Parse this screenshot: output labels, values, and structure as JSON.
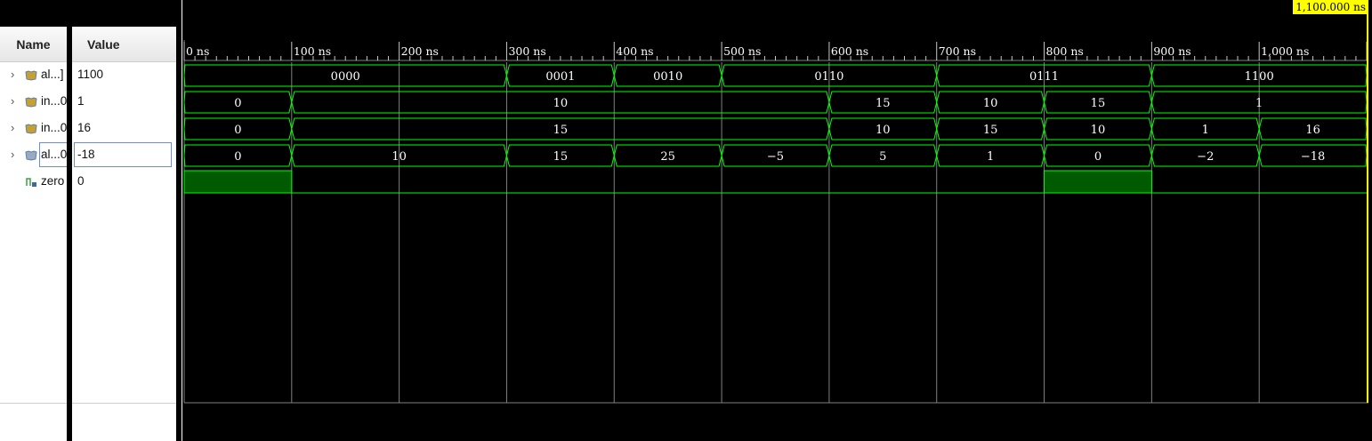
{
  "cursor_time": "1,100.000 ns",
  "headers": {
    "name": "Name",
    "value": "Value"
  },
  "signals": [
    {
      "name": "al...]",
      "value": "1100",
      "icon": "bus-icon",
      "expandable": true
    },
    {
      "name": "in...0",
      "value": "1",
      "icon": "bus-icon",
      "expandable": true
    },
    {
      "name": "in...0",
      "value": "16",
      "icon": "bus-icon",
      "expandable": true
    },
    {
      "name": "al...0",
      "value": "-18",
      "icon": "bus-icon",
      "expandable": true,
      "selected": true
    },
    {
      "name": "zero",
      "value": "0",
      "icon": "bit-icon",
      "expandable": false
    }
  ],
  "time_ticks": [
    "0 ns",
    "100 ns",
    "200 ns",
    "300 ns",
    "400 ns",
    "500 ns",
    "600 ns",
    "700 ns",
    "800 ns",
    "900 ns",
    "1,000 ns"
  ],
  "time_range_ns": [
    0,
    1100
  ],
  "colors": {
    "wave": "#00ff00",
    "bit_high_fill": "#005a00",
    "grid": "#808080",
    "cursor": "#ffff00",
    "text": "#ffffff"
  },
  "waves": [
    {
      "segments": [
        {
          "start": 0,
          "end": 300,
          "label": "0000"
        },
        {
          "start": 300,
          "end": 400,
          "label": "0001"
        },
        {
          "start": 400,
          "end": 500,
          "label": "0010"
        },
        {
          "start": 500,
          "end": 700,
          "label": "0110"
        },
        {
          "start": 700,
          "end": 900,
          "label": "0111"
        },
        {
          "start": 900,
          "end": 1100,
          "label": "1100"
        }
      ]
    },
    {
      "segments": [
        {
          "start": 0,
          "end": 100,
          "label": "0"
        },
        {
          "start": 100,
          "end": 600,
          "label": "10"
        },
        {
          "start": 600,
          "end": 700,
          "label": "15"
        },
        {
          "start": 700,
          "end": 800,
          "label": "10"
        },
        {
          "start": 800,
          "end": 900,
          "label": "15"
        },
        {
          "start": 900,
          "end": 1100,
          "label": "1"
        }
      ]
    },
    {
      "segments": [
        {
          "start": 0,
          "end": 100,
          "label": "0"
        },
        {
          "start": 100,
          "end": 600,
          "label": "15"
        },
        {
          "start": 600,
          "end": 700,
          "label": "10"
        },
        {
          "start": 700,
          "end": 800,
          "label": "15"
        },
        {
          "start": 800,
          "end": 900,
          "label": "10"
        },
        {
          "start": 900,
          "end": 1000,
          "label": "1"
        },
        {
          "start": 1000,
          "end": 1100,
          "label": "16"
        }
      ]
    },
    {
      "segments": [
        {
          "start": 0,
          "end": 100,
          "label": "0"
        },
        {
          "start": 100,
          "end": 300,
          "label": "10"
        },
        {
          "start": 300,
          "end": 400,
          "label": "15"
        },
        {
          "start": 400,
          "end": 500,
          "label": "25"
        },
        {
          "start": 500,
          "end": 600,
          "label": "−5"
        },
        {
          "start": 600,
          "end": 700,
          "label": "5"
        },
        {
          "start": 700,
          "end": 800,
          "label": "1"
        },
        {
          "start": 800,
          "end": 900,
          "label": "0"
        },
        {
          "start": 900,
          "end": 1000,
          "label": "−2"
        },
        {
          "start": 1000,
          "end": 1100,
          "label": "−18"
        }
      ]
    },
    {
      "bit": true,
      "segments": [
        {
          "start": 0,
          "end": 100,
          "level": 1
        },
        {
          "start": 100,
          "end": 800,
          "level": 0
        },
        {
          "start": 800,
          "end": 900,
          "level": 1
        },
        {
          "start": 900,
          "end": 1100,
          "level": 0
        }
      ]
    }
  ]
}
